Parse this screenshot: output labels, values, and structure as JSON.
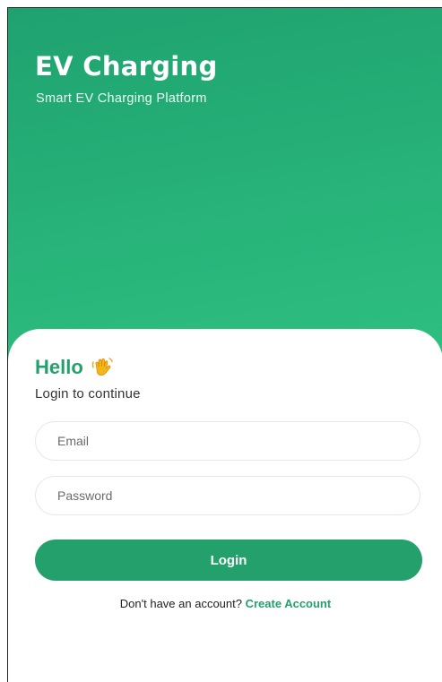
{
  "header": {
    "title": "EV Charging",
    "subtitle": "Smart EV Charging Platform"
  },
  "greeting": {
    "title": "Hello",
    "icon": "waving-hand-icon",
    "hint": "Login to continue"
  },
  "form": {
    "email_placeholder": "Email",
    "password_placeholder": "Password",
    "login_label": "Login"
  },
  "signup": {
    "prompt": "Don't have an account?",
    "link_label": "Create Account"
  },
  "colors": {
    "brand": "#24a06c",
    "hero_gradient_start": "#1fa270",
    "hero_gradient_end": "#2fbf82"
  }
}
